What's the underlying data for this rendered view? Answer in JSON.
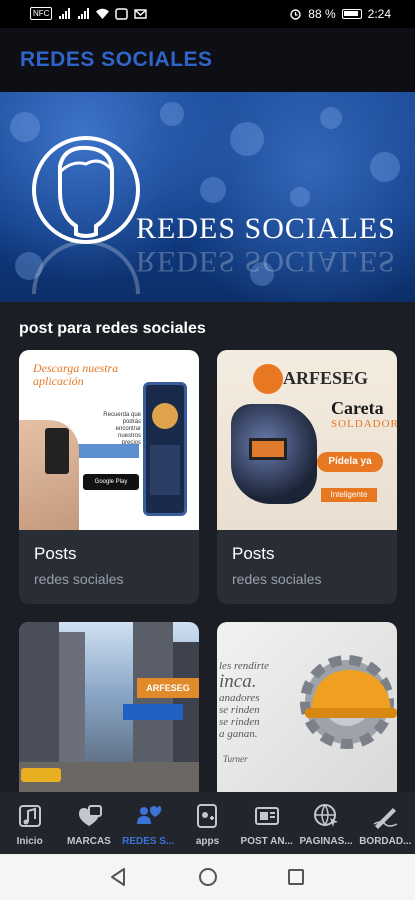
{
  "status_bar": {
    "chip": "NFC",
    "battery": "88 %",
    "time": "2:24"
  },
  "app_bar": {
    "title": "REDES SOCIALES"
  },
  "banner": {
    "text": "REDES SOCIALES"
  },
  "section": {
    "title": "post para redes sociales"
  },
  "cards": [
    {
      "title": "Posts",
      "subtitle": "redes sociales",
      "image_text": {
        "headline": "Descarga nuestra aplicación",
        "body": "Recuerda que podrás encontrar nuestros precios",
        "badge": "Google Play"
      }
    },
    {
      "title": "Posts",
      "subtitle": "redes sociales",
      "image_text": {
        "brand": "ARFESEG",
        "product_line1": "Careta",
        "product_line2": "SOLDADOR",
        "cta": "Pídela ya",
        "tag": "Inteligente"
      }
    },
    {
      "title": "",
      "subtitle": "",
      "image_text": {
        "sign": "ARFESEG"
      }
    },
    {
      "title": "",
      "subtitle": "",
      "image_text": {
        "line1": "les rendirte",
        "line2": "inca.",
        "line3": "anadores",
        "line4": "se rinden",
        "line5": "se rinden",
        "line6": "a ganan.",
        "author": "Turner"
      }
    }
  ],
  "bottom_nav": [
    {
      "label": "Inicio",
      "icon": "home-music-icon",
      "active": false
    },
    {
      "label": "MARCAS",
      "icon": "brands-icon",
      "active": false
    },
    {
      "label": "REDES S...",
      "icon": "social-people-icon",
      "active": true
    },
    {
      "label": "apps",
      "icon": "apps-icon",
      "active": false
    },
    {
      "label": "POST AN...",
      "icon": "post-icon",
      "active": false
    },
    {
      "label": "PAGINAS...",
      "icon": "web-globe-icon",
      "active": false
    },
    {
      "label": "BORDAD...",
      "icon": "embroidery-icon",
      "active": false
    }
  ],
  "colors": {
    "accent": "#2f64c9",
    "background": "#1b1e24",
    "card": "#292d35",
    "nav_active": "#3d72d6"
  }
}
